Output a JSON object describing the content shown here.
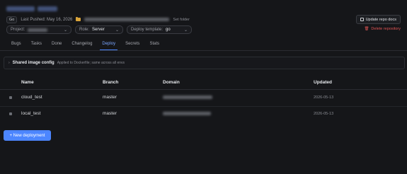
{
  "header": {
    "language_badge": "Go",
    "last_pushed": "Last Pushed: May 16, 2026",
    "set_folder": "Set folder",
    "update_docs": "Update repo docs",
    "delete_repo": "Delete repository"
  },
  "filters": {
    "project_label": "Project:",
    "role_label": "Role:",
    "role_value": "Server",
    "template_label": "Deploy template:",
    "template_value": "go"
  },
  "tabs": [
    {
      "label": "Bugs"
    },
    {
      "label": "Tasks"
    },
    {
      "label": "Done"
    },
    {
      "label": "Changelog"
    },
    {
      "label": "Deploy"
    },
    {
      "label": "Secrets"
    },
    {
      "label": "Stats"
    }
  ],
  "active_tab": "Deploy",
  "shared_config": {
    "chevron": "›",
    "title": "Shared image config",
    "description": "Applied to Dockerfile; same across all envs"
  },
  "table": {
    "columns": [
      "Name",
      "Branch",
      "Domain",
      "Updated"
    ],
    "rows": [
      {
        "name": "cloud_test",
        "branch": "master",
        "updated": "2026-05-13"
      },
      {
        "name": "local_test",
        "branch": "master",
        "updated": "2026-05-13"
      }
    ]
  },
  "new_deployment": "+ New deployment",
  "colors": {
    "accent": "#4c86ff",
    "danger": "#e05555",
    "background": "#151619"
  }
}
